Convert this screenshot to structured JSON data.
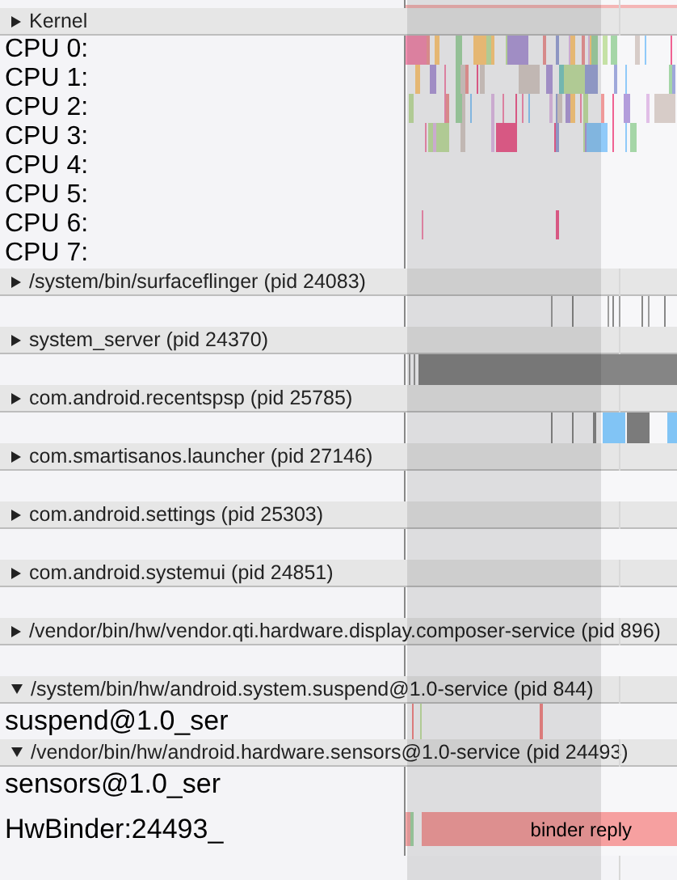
{
  "groups": [
    {
      "title": "Kernel",
      "expanded": false,
      "rows": [
        {
          "kind": "cpu",
          "label": "CPU 0:"
        },
        {
          "kind": "cpu",
          "label": "CPU 1:"
        },
        {
          "kind": "cpu",
          "label": "CPU 2:"
        },
        {
          "kind": "cpu",
          "label": "CPU 3:"
        },
        {
          "kind": "cpu",
          "label": "CPU 4:"
        },
        {
          "kind": "cpu",
          "label": "CPU 5:"
        },
        {
          "kind": "cpu",
          "label": "CPU 6:"
        },
        {
          "kind": "cpu",
          "label": "CPU 7:"
        }
      ]
    },
    {
      "title": "/system/bin/surfaceflinger (pid 24083)",
      "expanded": false,
      "rows": [
        {
          "kind": "summary"
        }
      ]
    },
    {
      "title": "system_server (pid 24370)",
      "expanded": false,
      "rows": [
        {
          "kind": "summary"
        }
      ]
    },
    {
      "title": "com.android.recentspsp (pid 25785)",
      "expanded": false,
      "rows": [
        {
          "kind": "summary"
        }
      ]
    },
    {
      "title": "com.smartisanos.launcher (pid 27146)",
      "expanded": false,
      "rows": [
        {
          "kind": "summary"
        }
      ]
    },
    {
      "title": "com.android.settings (pid 25303)",
      "expanded": false,
      "rows": [
        {
          "kind": "summary"
        }
      ]
    },
    {
      "title": "com.android.systemui (pid 24851)",
      "expanded": false,
      "rows": [
        {
          "kind": "summary"
        }
      ]
    },
    {
      "title": "/vendor/bin/hw/vendor.qti.hardware.display.composer-service (pid 896)",
      "expanded": false,
      "rows": [
        {
          "kind": "summary"
        }
      ]
    },
    {
      "title": "/system/bin/hw/android.system.suspend@1.0-service (pid 844)",
      "expanded": true,
      "rows": [
        {
          "kind": "thread",
          "label": "suspend@1.0_ser"
        }
      ]
    },
    {
      "title": "/vendor/bin/hw/android.hardware.sensors@1.0-service (pid 24493)",
      "expanded": true,
      "rows": [
        {
          "kind": "thread",
          "label": "sensors@1.0_ser"
        },
        {
          "kind": "binder",
          "label": "HwBinder:24493_",
          "slices": [
            {
              "label": "binder reply"
            }
          ]
        }
      ]
    }
  ]
}
